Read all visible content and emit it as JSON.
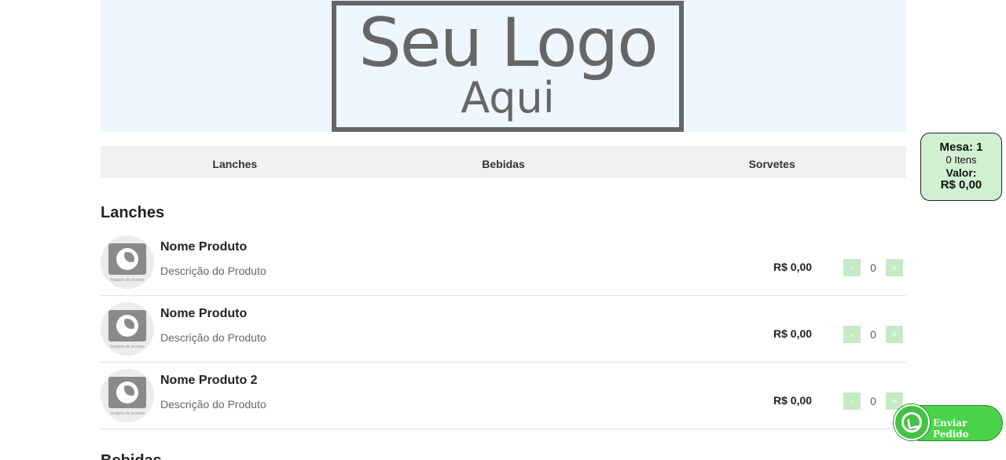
{
  "header": {
    "logo_line1": "Seu Logo",
    "logo_line2": "Aqui"
  },
  "categories": [
    {
      "label": "Lanches"
    },
    {
      "label": "Bebidas"
    },
    {
      "label": "Sorvetes"
    }
  ],
  "sections": [
    {
      "title": "Lanches",
      "products": [
        {
          "name": "Nome Produto",
          "description": "Descrição do Produto",
          "price": "R$ 0,00",
          "qty": "0",
          "minus": "-",
          "plus": "+",
          "image_caption": "Imagem do produto"
        },
        {
          "name": "Nome Produto",
          "description": "Descrição do Produto",
          "price": "R$ 0,00",
          "qty": "0",
          "minus": "-",
          "plus": "+",
          "image_caption": "Imagem do produto"
        },
        {
          "name": "Nome Produto 2",
          "description": "Descrição do Produto",
          "price": "R$ 0,00",
          "qty": "0",
          "minus": "-",
          "plus": "+",
          "image_caption": "Imagem do produto"
        }
      ]
    },
    {
      "title": "Bebidas"
    }
  ],
  "cart": {
    "mesa": "Mesa: 1",
    "itens": "0 Itens",
    "valor_label": "Valor:",
    "valor": "R$ 0,00"
  },
  "whatsapp": {
    "label": "Enviar Pedido",
    "icon": "whatsapp-icon"
  },
  "colors": {
    "banner_bg": "#eef6ff",
    "nav_bg": "#f1f1f1",
    "qty_button": "#c6eac6",
    "cart_bg": "#d1f0d1",
    "whatsapp_green": "#4ad34a"
  }
}
